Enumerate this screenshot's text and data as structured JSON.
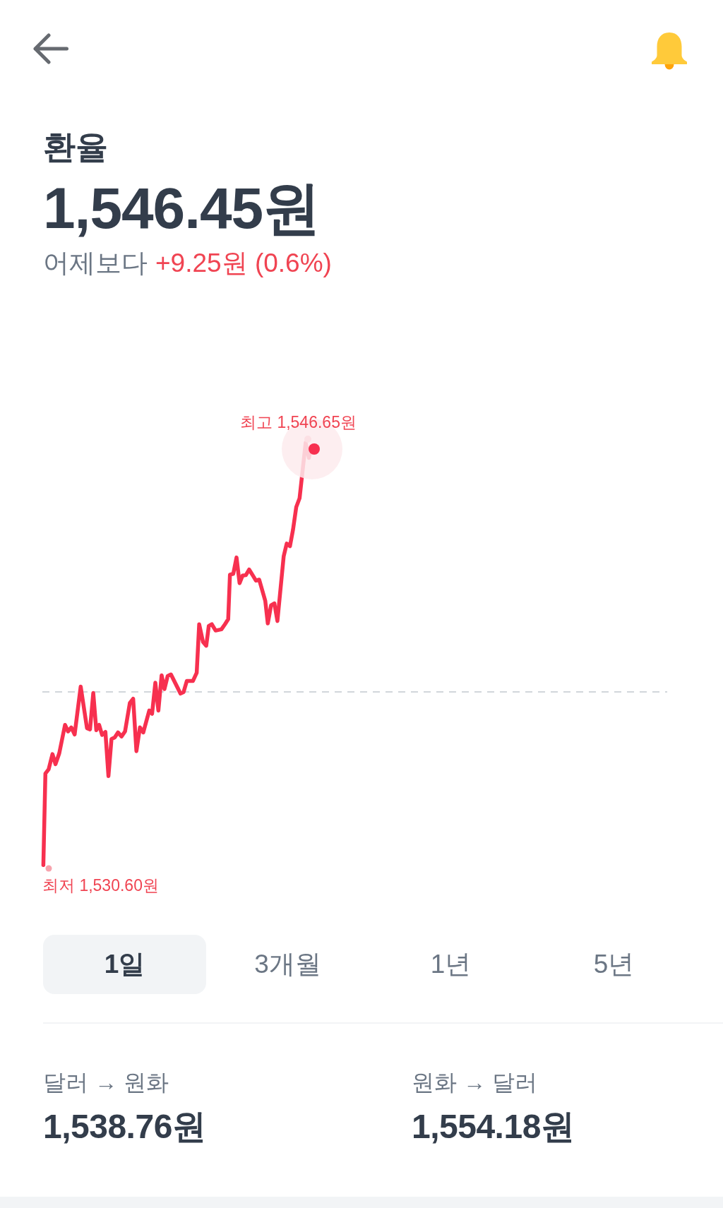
{
  "title": "환율",
  "price": "1,546.45원",
  "change": {
    "label": "어제보다",
    "value": "+9.25원 (0.6%)"
  },
  "chart": {
    "high_label": "최고 1,546.65원",
    "low_label": "최저 1,530.60원"
  },
  "periods": [
    {
      "label": "1일",
      "selected": true
    },
    {
      "label": "3개월",
      "selected": false
    },
    {
      "label": "1년",
      "selected": false
    },
    {
      "label": "5년",
      "selected": false
    }
  ],
  "conversions": [
    {
      "label": "달러 → 원화",
      "value": "1,538.76원"
    },
    {
      "label": "원화 → 달러",
      "value": "1,554.18원"
    }
  ]
}
